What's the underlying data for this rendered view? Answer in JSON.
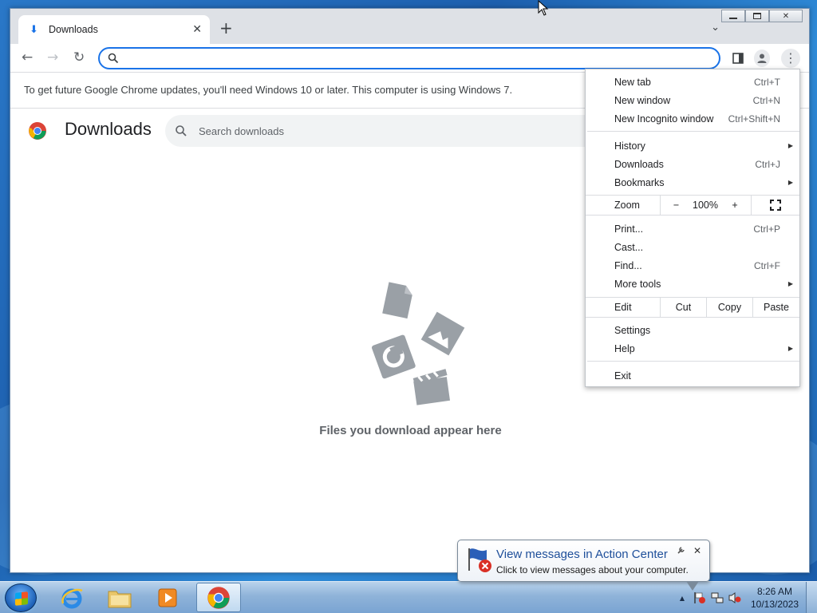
{
  "window": {
    "controls": {
      "minimize": "▭",
      "restore": "▣",
      "close": "✕"
    }
  },
  "tab": {
    "title": "Downloads",
    "icon": "download-icon",
    "close": "✕"
  },
  "toolbar": {
    "new_tab": "+",
    "tab_search": "⌄",
    "back": "←",
    "forward": "→",
    "reload": "↻",
    "omnibox_value": "",
    "kebab": "⋮"
  },
  "infobar": {
    "text": "To get future Google Chrome updates, you'll need Windows 10 or later. This computer is using Windows 7."
  },
  "downloads": {
    "title": "Downloads",
    "search_placeholder": "Search downloads",
    "empty_text": "Files you download appear here"
  },
  "menu": {
    "group1": [
      {
        "label": "New tab",
        "shortcut": "Ctrl+T"
      },
      {
        "label": "New window",
        "shortcut": "Ctrl+N"
      },
      {
        "label": "New Incognito window",
        "shortcut": "Ctrl+Shift+N"
      }
    ],
    "group2": [
      {
        "label": "History",
        "shortcut": ""
      },
      {
        "label": "Downloads",
        "shortcut": "Ctrl+J"
      },
      {
        "label": "Bookmarks",
        "shortcut": ""
      }
    ],
    "zoom": {
      "label": "Zoom",
      "minus": "−",
      "value": "100%",
      "plus": "+"
    },
    "group3": [
      {
        "label": "Print...",
        "shortcut": "Ctrl+P"
      },
      {
        "label": "Cast...",
        "shortcut": ""
      },
      {
        "label": "Find...",
        "shortcut": "Ctrl+F"
      },
      {
        "label": "More tools",
        "shortcut": ""
      }
    ],
    "edit": {
      "label": "Edit",
      "cut": "Cut",
      "copy": "Copy",
      "paste": "Paste"
    },
    "group4": [
      {
        "label": "Settings",
        "shortcut": ""
      },
      {
        "label": "Help",
        "shortcut": ""
      }
    ],
    "exit": {
      "label": "Exit"
    }
  },
  "balloon": {
    "title": "View messages in Action Center",
    "body": "Click to view messages about your computer.",
    "close": "✕",
    "wrench": "🔧"
  },
  "taskbar": {
    "apps": [
      "internet-explorer",
      "file-explorer",
      "media-player",
      "chrome"
    ],
    "tray_arrow": "▲",
    "time": "8:26 AM",
    "date": "10/13/2023"
  },
  "colors": {
    "accent": "#1a73e8",
    "menu_text": "#202124",
    "secondary_text": "#5f6368"
  }
}
